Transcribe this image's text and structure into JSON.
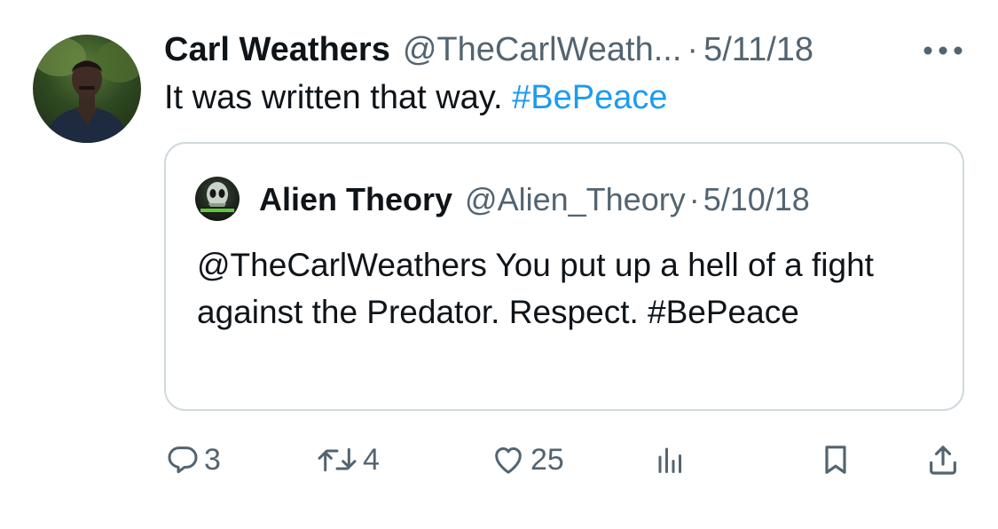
{
  "tweet": {
    "author_name": "Carl Weathers",
    "author_handle": "@TheCarlWeath...",
    "separator": "·",
    "date": "5/11/18",
    "text_plain": "It was written that way.",
    "text_hashtag": "#BePeace"
  },
  "quoted_tweet": {
    "author_name": "Alien Theory",
    "author_handle": "@Alien_Theory",
    "separator": "·",
    "date": "5/10/18",
    "text": "@TheCarlWeathers You put up a hell of a fight against the Predator. Respect. #BePeace",
    "avatar_caption": "ALIEN THEORY"
  },
  "actions": {
    "replies": "3",
    "retweets": "4",
    "likes": "25"
  },
  "colors": {
    "text": "#0f1419",
    "secondary": "#536471",
    "link": "#1d9bf0",
    "border": "#cfd9de"
  },
  "icons": [
    "more-icon",
    "reply-icon",
    "retweet-icon",
    "like-icon",
    "views-icon",
    "bookmark-icon",
    "share-icon"
  ]
}
